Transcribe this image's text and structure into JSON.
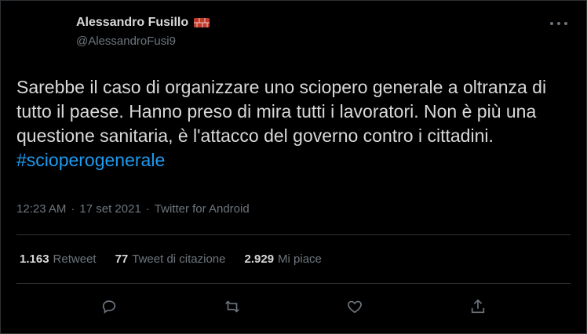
{
  "author": {
    "display_name": "Alessandro Fusillo",
    "handle": "@AlessandroFusi9",
    "badge_icon": "brick-icon"
  },
  "tweet": {
    "text": "Sarebbe il caso di organizzare uno sciopero generale a oltranza di tutto il paese. Hanno preso di mira tutti i lavoratori. Non è più una questione sanitaria, è l'attacco del governo contro i cittadini.",
    "hashtag": "#scioperogenerale",
    "time": "12:23 AM",
    "date": "17 set 2021",
    "source": "Twitter for Android",
    "separator": "·"
  },
  "stats": {
    "retweets": {
      "count": "1.163",
      "label": "Retweet"
    },
    "quotes": {
      "count": "77",
      "label": "Tweet di citazione"
    },
    "likes": {
      "count": "2.929",
      "label": "Mi piace"
    }
  },
  "colors": {
    "background": "#000000",
    "text": "#d9d9d9",
    "muted": "#6e767d",
    "link": "#1d9bf0",
    "border": "#2f3336"
  }
}
